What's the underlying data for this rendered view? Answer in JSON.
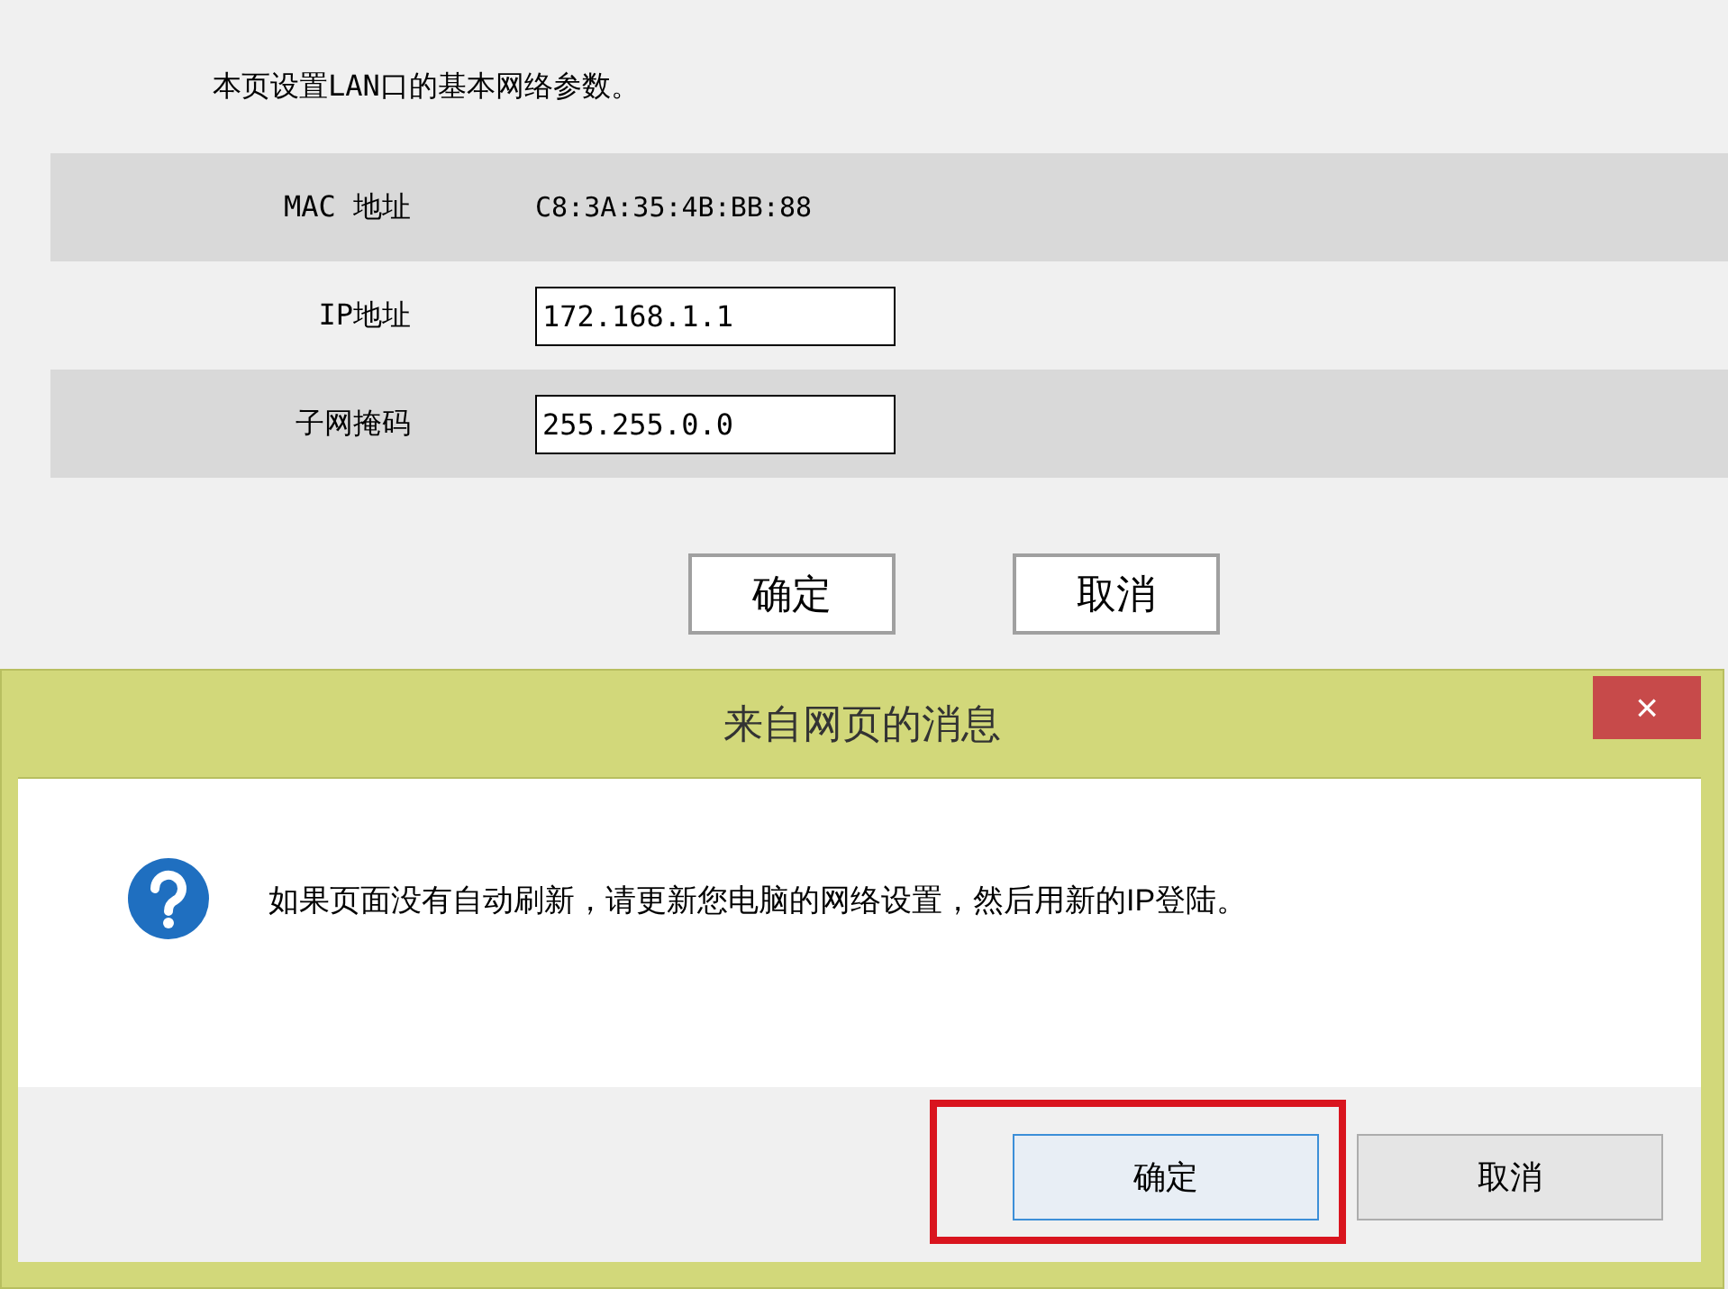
{
  "intro": "本页设置LAN口的基本网络参数。",
  "fields": [
    {
      "kind": "text",
      "label": "MAC 地址",
      "value": "C8:3A:35:4B:BB:88"
    },
    {
      "kind": "input",
      "label": "IP地址",
      "value": "172.168.1.1"
    },
    {
      "kind": "input",
      "label": "子网掩码",
      "value": "255.255.0.0"
    }
  ],
  "buttons": [
    "确定",
    "取消"
  ],
  "dialog": {
    "title": "来自网页的消息",
    "close": "×",
    "message": "如果页面没有自动刷新，请更新您电脑的网络设置，然后用新的IP登陆。",
    "buttons": [
      {
        "label": "确定",
        "default": true,
        "annotated": true
      },
      {
        "label": "取消",
        "default": false,
        "annotated": false
      }
    ]
  }
}
